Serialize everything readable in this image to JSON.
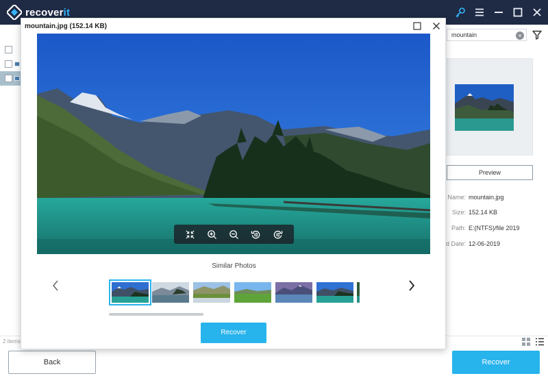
{
  "app": {
    "name_main": "recover",
    "name_accent": "it"
  },
  "topbar": {
    "icons": [
      "key-icon",
      "menu-icon",
      "minimize-icon",
      "maximize-icon",
      "close-icon"
    ]
  },
  "search": {
    "value": "mountain"
  },
  "details": {
    "preview_label": "Preview",
    "fields": [
      {
        "label": "Name:",
        "value": "mountain.jpg"
      },
      {
        "label": "Size:",
        "value": "152.14  KB"
      },
      {
        "label": "Path:",
        "value": "E:(NTFS)/file 2019"
      },
      {
        "label": "d Date:",
        "value": "12-06-2019"
      }
    ]
  },
  "list": {
    "items_count": "2 items"
  },
  "footer": {
    "back_label": "Back",
    "recover_label": "Recover"
  },
  "modal": {
    "title": "mountain.jpg (152.14  KB)",
    "similar_title": "Similar Photos",
    "recover_label": "Recover",
    "toolbar": [
      "fit-screen-icon",
      "zoom-in-icon",
      "zoom-out-icon",
      "rotate-left-icon",
      "rotate-right-icon"
    ]
  },
  "colors": {
    "accent": "#27b3ec",
    "topbar": "#1f2a44"
  }
}
